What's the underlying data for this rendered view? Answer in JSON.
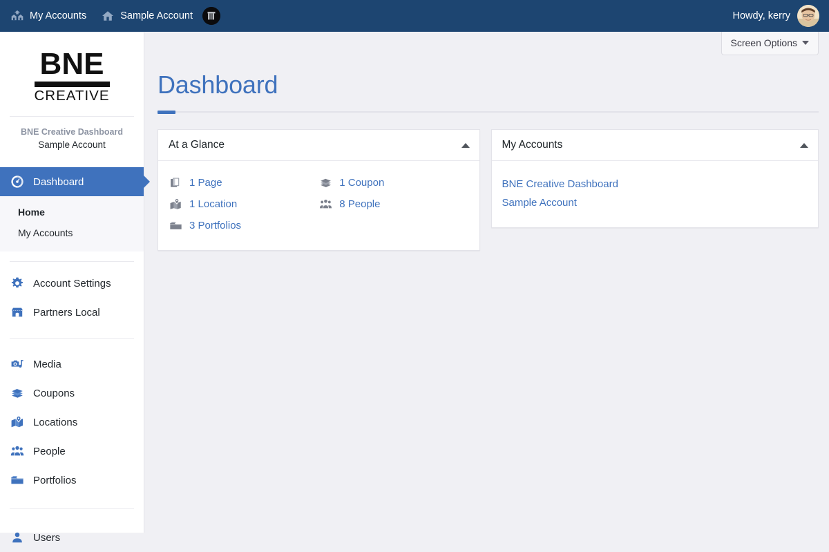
{
  "adminbar": {
    "items": [
      {
        "label": "My Accounts",
        "icon": "network-houses-icon"
      },
      {
        "label": "Sample Account",
        "icon": "house-icon"
      }
    ],
    "site_logo_icon": "site-logo-icon",
    "howdy": "Howdy, kerry",
    "avatar_icon": "user-avatar"
  },
  "sidebar": {
    "logo": {
      "primary": "BNE",
      "secondary": "CREATIVE"
    },
    "brand_title": "BNE Creative Dashboard",
    "brand_subtitle": "Sample Account",
    "nav": [
      {
        "label": "Dashboard",
        "icon": "dashboard-icon",
        "active": true
      },
      {
        "label": "Account Settings",
        "icon": "gear-icon",
        "active": false
      },
      {
        "label": "Partners Local",
        "icon": "store-icon",
        "active": false
      },
      {
        "label": "Media",
        "icon": "media-icon",
        "active": false
      },
      {
        "label": "Coupons",
        "icon": "coupon-icon",
        "active": false
      },
      {
        "label": "Locations",
        "icon": "location-pin-icon",
        "active": false
      },
      {
        "label": "People",
        "icon": "people-icon",
        "active": false
      },
      {
        "label": "Portfolios",
        "icon": "folder-icon",
        "active": false
      },
      {
        "label": "Users",
        "icon": "user-icon",
        "active": false
      }
    ],
    "submenu": [
      {
        "label": "Home",
        "current": true
      },
      {
        "label": "My Accounts",
        "current": false
      }
    ]
  },
  "content": {
    "screen_options_label": "Screen Options",
    "page_title": "Dashboard",
    "glance": {
      "title": "At a Glance",
      "collapse_icon": "chevron-up-icon",
      "left_items": [
        {
          "label": "1 Page",
          "icon": "pages-icon"
        },
        {
          "label": "1 Location",
          "icon": "location-pin-icon"
        },
        {
          "label": "3 Portfolios",
          "icon": "folder-icon"
        }
      ],
      "right_items": [
        {
          "label": "1 Coupon",
          "icon": "coupon-icon"
        },
        {
          "label": "8 People",
          "icon": "people-icon"
        }
      ]
    },
    "accounts": {
      "title": "My Accounts",
      "collapse_icon": "chevron-up-icon",
      "links": [
        {
          "label": "BNE Creative Dashboard"
        },
        {
          "label": "Sample Account"
        }
      ]
    }
  },
  "colors": {
    "adminbar_bg": "#1d4571",
    "accent_blue": "#3f72bd",
    "link_blue": "#3f72bd",
    "content_bg": "#f0f0f4",
    "icon_gray": "#6f7480"
  }
}
